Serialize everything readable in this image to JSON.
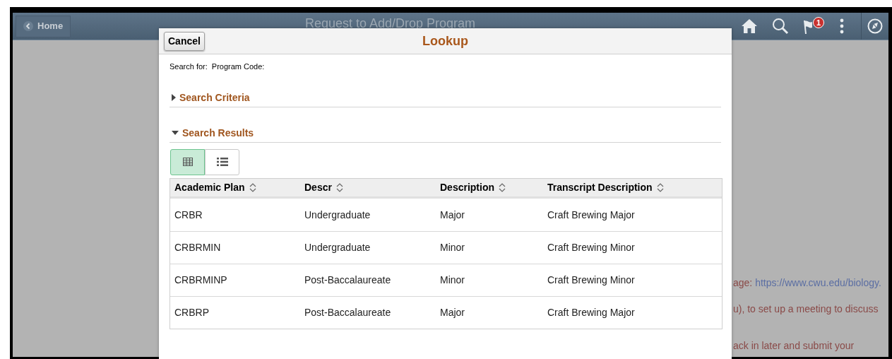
{
  "header": {
    "back_label": "Home",
    "title": "Request to Add/Drop Program",
    "notification_count": "1"
  },
  "background_text": [
    {
      "kind": "link_line",
      "text": "age: ",
      "link": "https://www.cwu.edu/biology."
    },
    {
      "kind": "plain",
      "text": "u),  to set up a meeting to discuss"
    },
    {
      "kind": "plain",
      "text": "ack in later and submit your"
    }
  ],
  "lookup": {
    "cancel": "Cancel",
    "title": "Lookup",
    "search_for_label": "Search for:",
    "search_for_value": "Program Code:",
    "sections": [
      {
        "label": "Search Criteria",
        "expanded": false
      },
      {
        "label": "Search Results",
        "expanded": true
      }
    ],
    "views": [
      {
        "kind": "grid",
        "selected": true
      },
      {
        "kind": "list",
        "selected": false
      }
    ],
    "table": {
      "columns": [
        "Academic Plan",
        "Descr",
        "Description",
        "Transcript Description"
      ],
      "rows": [
        [
          "CRBR",
          "Undergraduate",
          "Major",
          "Craft Brewing Major"
        ],
        [
          "CRBRMIN",
          "Undergraduate",
          "Minor",
          "Craft Brewing Minor"
        ],
        [
          "CRBRMINP",
          "Post-Baccalaureate",
          "Minor",
          "Craft Brewing Minor"
        ],
        [
          "CRBRP",
          "Post-Baccalaureate",
          "Major",
          "Craft Brewing Major"
        ]
      ]
    }
  }
}
